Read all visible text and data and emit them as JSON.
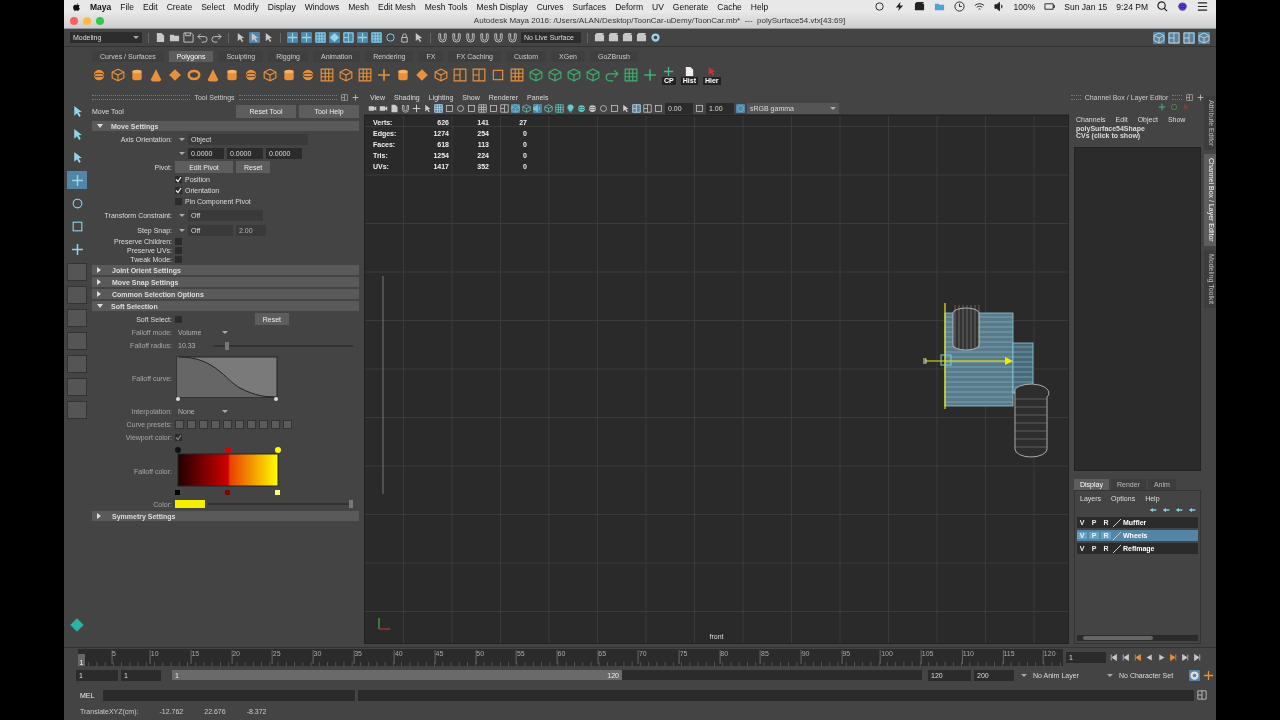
{
  "menubar": {
    "app": "Maya",
    "menus": [
      "File",
      "Edit",
      "Create",
      "Select",
      "Modify",
      "Display",
      "Windows",
      "Mesh",
      "Edit Mesh",
      "Mesh Tools",
      "Mesh Display",
      "Curves",
      "Surfaces",
      "Deform",
      "UV",
      "Generate",
      "Cache",
      "Help"
    ],
    "battery": "100%",
    "date": "Sun Jan 15",
    "time": "9:24 PM"
  },
  "window": {
    "title": "Autodesk Maya 2016: /Users/ALAN/Desktop/ToonCar-uDemy/ToonCar.mb*  ---  polySurface54.vtx[43:69]"
  },
  "status_line": {
    "mode": "Modeling",
    "mask_buttons": [
      {
        "selected": true
      },
      {
        "selected": true
      },
      {
        "selected": true
      },
      {
        "selected": true
      },
      {
        "selected": true
      },
      {
        "selected": true
      },
      {
        "selected": true
      },
      {
        "selected": false
      }
    ],
    "live_surface": "No Live Surface",
    "panel_buttons": [
      {
        "selected": true
      },
      {
        "selected": true
      },
      {
        "selected": true
      },
      {
        "selected": true
      }
    ]
  },
  "shelf": {
    "tabs": [
      {
        "label": "Curves / Surfaces",
        "selected": false
      },
      {
        "label": "Polygons",
        "selected": true
      },
      {
        "label": "Sculpting",
        "selected": false
      },
      {
        "label": "Rigging",
        "selected": false
      },
      {
        "label": "Animation",
        "selected": false
      },
      {
        "label": "Rendering",
        "selected": false
      },
      {
        "label": "FX",
        "selected": false
      },
      {
        "label": "FX Caching",
        "selected": false
      },
      {
        "label": "Custom",
        "selected": false
      },
      {
        "label": "XGen",
        "selected": false
      },
      {
        "label": "GoZBrush",
        "selected": false
      }
    ],
    "labels": [
      "CP",
      "Hist",
      "Hier"
    ]
  },
  "toolbox": {
    "tools": [
      {
        "selected": false
      },
      {
        "selected": false
      },
      {
        "selected": false
      },
      {
        "selected": true
      },
      {
        "selected": false
      },
      {
        "selected": false
      },
      {
        "selected": false
      }
    ]
  },
  "tool_settings": {
    "title": "Tool Settings",
    "tool": "Move Tool",
    "buttons": [
      "Reset Tool",
      "Tool Help"
    ],
    "sections": [
      {
        "title": "Move Settings",
        "expanded": true,
        "move_settings": {
          "axis_label": "Axis Orientation:",
          "axis_value": "Object",
          "axis_values": [
            "0.0000",
            "0.0000",
            "0.0000"
          ],
          "pivot_label": "Pivot:",
          "pivot_buttons": [
            "Edit Pivot",
            "Reset"
          ],
          "pivot_options": [
            {
              "label": "Position",
              "checked": true
            },
            {
              "label": "Orientation",
              "checked": true
            },
            {
              "label": "Pin Component Pivot",
              "checked": false
            }
          ],
          "constraint_label": "Transform Constraint:",
          "constraint_value": "Off",
          "snap_label": "Step Snap:",
          "snap_value": "Off",
          "snap_amount": "2.00",
          "toggles": [
            {
              "label": "Preserve Children:",
              "checked": false
            },
            {
              "label": "Preserve UVs:",
              "checked": false
            },
            {
              "label": "Tweak Mode:",
              "checked": false
            }
          ]
        }
      },
      {
        "title": "Joint Orient Settings",
        "expanded": false
      },
      {
        "title": "Move Snap Settings",
        "expanded": false
      },
      {
        "title": "Common Selection Options",
        "expanded": false
      },
      {
        "title": "Soft Selection",
        "expanded": true,
        "soft_selection": {
          "soft_select_label": "Soft Select:",
          "soft_select": false,
          "reset": "Reset",
          "falloff_mode_label": "Falloff mode:",
          "falloff_mode": "Volume",
          "falloff_radius_label": "Falloff radius:",
          "falloff_radius": "10.33",
          "radius_slider": {
            "level": 0.1
          },
          "curve_label": "Falloff curve:",
          "interpolation_label": "Interpolation:",
          "interpolation": "None",
          "presets_label": "Curve presets:",
          "viewport_color_label": "Viewport color:",
          "viewport_color": true,
          "falloff_color_label": "Falloff color:",
          "color_label": "Color:",
          "color_slider": {
            "level": 1
          }
        }
      },
      {
        "title": "Symmetry Settings",
        "expanded": false
      }
    ]
  },
  "viewport": {
    "menus": [
      "View",
      "Shading",
      "Lighting",
      "Show",
      "Renderer",
      "Panels"
    ],
    "toolbar": [
      {
        "selected": false
      },
      {
        "selected": false
      },
      {
        "selected": false
      },
      {
        "selected": false
      },
      {
        "selected": false
      },
      {
        "selected": false
      },
      {
        "selected": true
      },
      {
        "selected": false
      },
      {
        "selected": false
      },
      {
        "selected": false
      },
      {
        "selected": false
      },
      {
        "selected": false
      },
      {
        "selected": false
      },
      {
        "selected": true
      },
      {
        "selected": false
      },
      {
        "selected": true
      },
      {
        "selected": false
      },
      {
        "selected": false
      },
      {
        "selected": false
      },
      {
        "selected": false
      },
      {
        "selected": false
      },
      {
        "selected": false
      },
      {
        "selected": false
      },
      {
        "selected": false
      },
      {
        "selected": true
      },
      {
        "selected": false
      },
      {
        "selected": false
      }
    ],
    "exposure": "0.00",
    "gamma": "1.00",
    "color_space": "sRGB gamma",
    "hud": [
      {
        "label": "Verts:",
        "values": [
          "626",
          "141",
          "27"
        ]
      },
      {
        "label": "Edges:",
        "values": [
          "1274",
          "254",
          "0"
        ]
      },
      {
        "label": "Faces:",
        "values": [
          "618",
          "113",
          "0"
        ]
      },
      {
        "label": "Tris:",
        "values": [
          "1254",
          "224",
          "0"
        ]
      },
      {
        "label": "UVs:",
        "values": [
          "1417",
          "352",
          "0"
        ]
      }
    ],
    "camera": "front"
  },
  "channel_box": {
    "title": "Channel Box / Layer Editor",
    "menus": [
      "Channels",
      "Edit",
      "Object",
      "Show"
    ],
    "object": "polySurface54Shape",
    "cvs": "CVs (click to show)"
  },
  "layer_editor": {
    "tabs": [
      {
        "label": "Display",
        "selected": true
      },
      {
        "label": "Render",
        "selected": false
      },
      {
        "label": "Anim",
        "selected": false
      }
    ],
    "menus": [
      "Layers",
      "Options",
      "Help"
    ],
    "layers": [
      {
        "flags": [
          "V",
          "P",
          "R"
        ],
        "name": "Muffler",
        "selected": false
      },
      {
        "flags": [
          "V",
          "P",
          "R"
        ],
        "name": "Wheels",
        "selected": true
      },
      {
        "flags": [
          "V",
          "P",
          "R"
        ],
        "name": "RefImage",
        "selected": false
      }
    ]
  },
  "side_tabs": [
    {
      "label": "Attribute Editor",
      "selected": false
    },
    {
      "label": "Channel Box / Layer Editor",
      "selected": true
    },
    {
      "label": "Modeling Toolkit",
      "selected": false
    }
  ],
  "timeline": {
    "current_marker": "1",
    "level": 0,
    "ticks": [
      "5",
      "10",
      "15",
      "20",
      "25",
      "30",
      "35",
      "40",
      "45",
      "50",
      "55",
      "60",
      "65",
      "70",
      "75",
      "80",
      "85",
      "90",
      "95",
      "100",
      "105",
      "110",
      "115",
      "120"
    ],
    "current": "1"
  },
  "range": {
    "start": "1",
    "inner_start": "1",
    "slider_start": "1",
    "slider_end": "120",
    "level": 0.6,
    "inner_end": "120",
    "end": "200",
    "anim_layer": "No Anim Layer",
    "character_set": "No Character Set"
  },
  "command_line": {
    "language": "MEL"
  },
  "help_line": {
    "label": "TranslateXYZ(cm):",
    "values": [
      "-12.762",
      "22.676",
      "-8.372"
    ]
  }
}
